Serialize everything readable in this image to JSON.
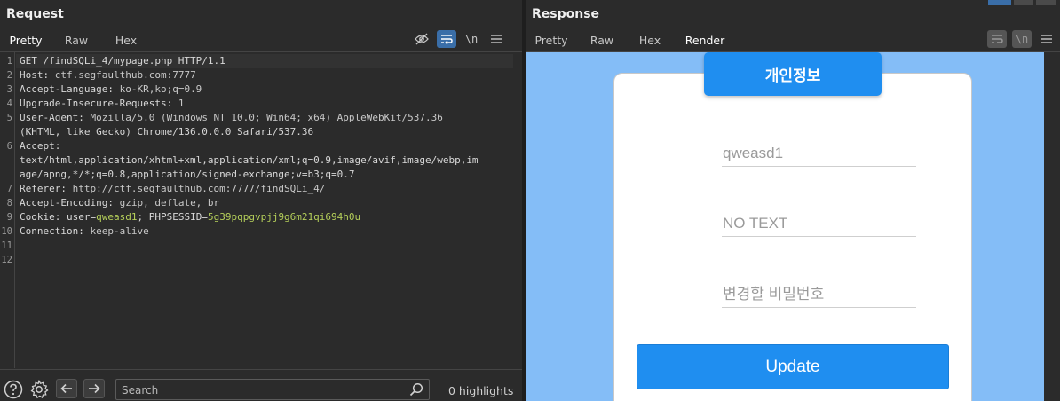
{
  "request": {
    "title": "Request",
    "tabs": [
      "Pretty",
      "Raw",
      "Hex"
    ],
    "active_tab": "Pretty",
    "line_numbers": [
      "1",
      "2",
      "3",
      "4",
      "5",
      "",
      "6",
      "",
      "",
      "7",
      "8",
      "9",
      "10",
      "11",
      "12"
    ],
    "lines": {
      "l1": "GET /findSQLi_4/mypage.php HTTP/1.1",
      "l2_name": "Host",
      "l2_val": "ctf.segfaulthub.com:7777",
      "l3_name": "Accept-Language",
      "l3_val": "ko-KR,ko;q=0.9",
      "l4_name": "Upgrade-Insecure-Requests",
      "l4_val": "1",
      "l5_name": "User-Agent",
      "l5_val": "Mozilla/5.0 (Windows NT 10.0; Win64; x64) AppleWebKit/537.36",
      "l5b": "(KHTML, like Gecko) Chrome/136.0.0.0 Safari/537.36",
      "l6_name": "Accept",
      "l6b": "text/html,application/xhtml+xml,application/xml;q=0.9,image/avif,image/webp,im",
      "l6c": "age/apng,*/*;q=0.8,application/signed-exchange;v=b3;q=0.7",
      "l7_name": "Referer",
      "l7_val": "http://ctf.segfaulthub.com:7777/findSQLi_4/",
      "l8_name": "Accept-Encoding",
      "l8_val": "gzip, deflate, br",
      "l9_name": "Cookie",
      "l9_k1": "user",
      "l9_v1": "qweasd1",
      "l9_k2": "PHPSESSID",
      "l9_v2": "5g39pqpgvpjj9g6m21qi694h0u",
      "l10_name": "Connection",
      "l10_val": "keep-alive"
    },
    "search_placeholder": "Search",
    "highlights": "0 highlights"
  },
  "response": {
    "title": "Response",
    "tabs": [
      "Pretty",
      "Raw",
      "Hex",
      "Render"
    ],
    "active_tab": "Render",
    "render": {
      "card_title": "개인정보",
      "field_id": "qweasd1",
      "field_info": "NO TEXT",
      "field_password_placeholder": "변경할 비밀번호",
      "update_label": "Update"
    }
  },
  "colors": {
    "accent_tab": "#e8703a",
    "render_bg": "#84bdf7",
    "button_blue": "#1f8ef0",
    "cookie_value": "#b5cf5a"
  }
}
